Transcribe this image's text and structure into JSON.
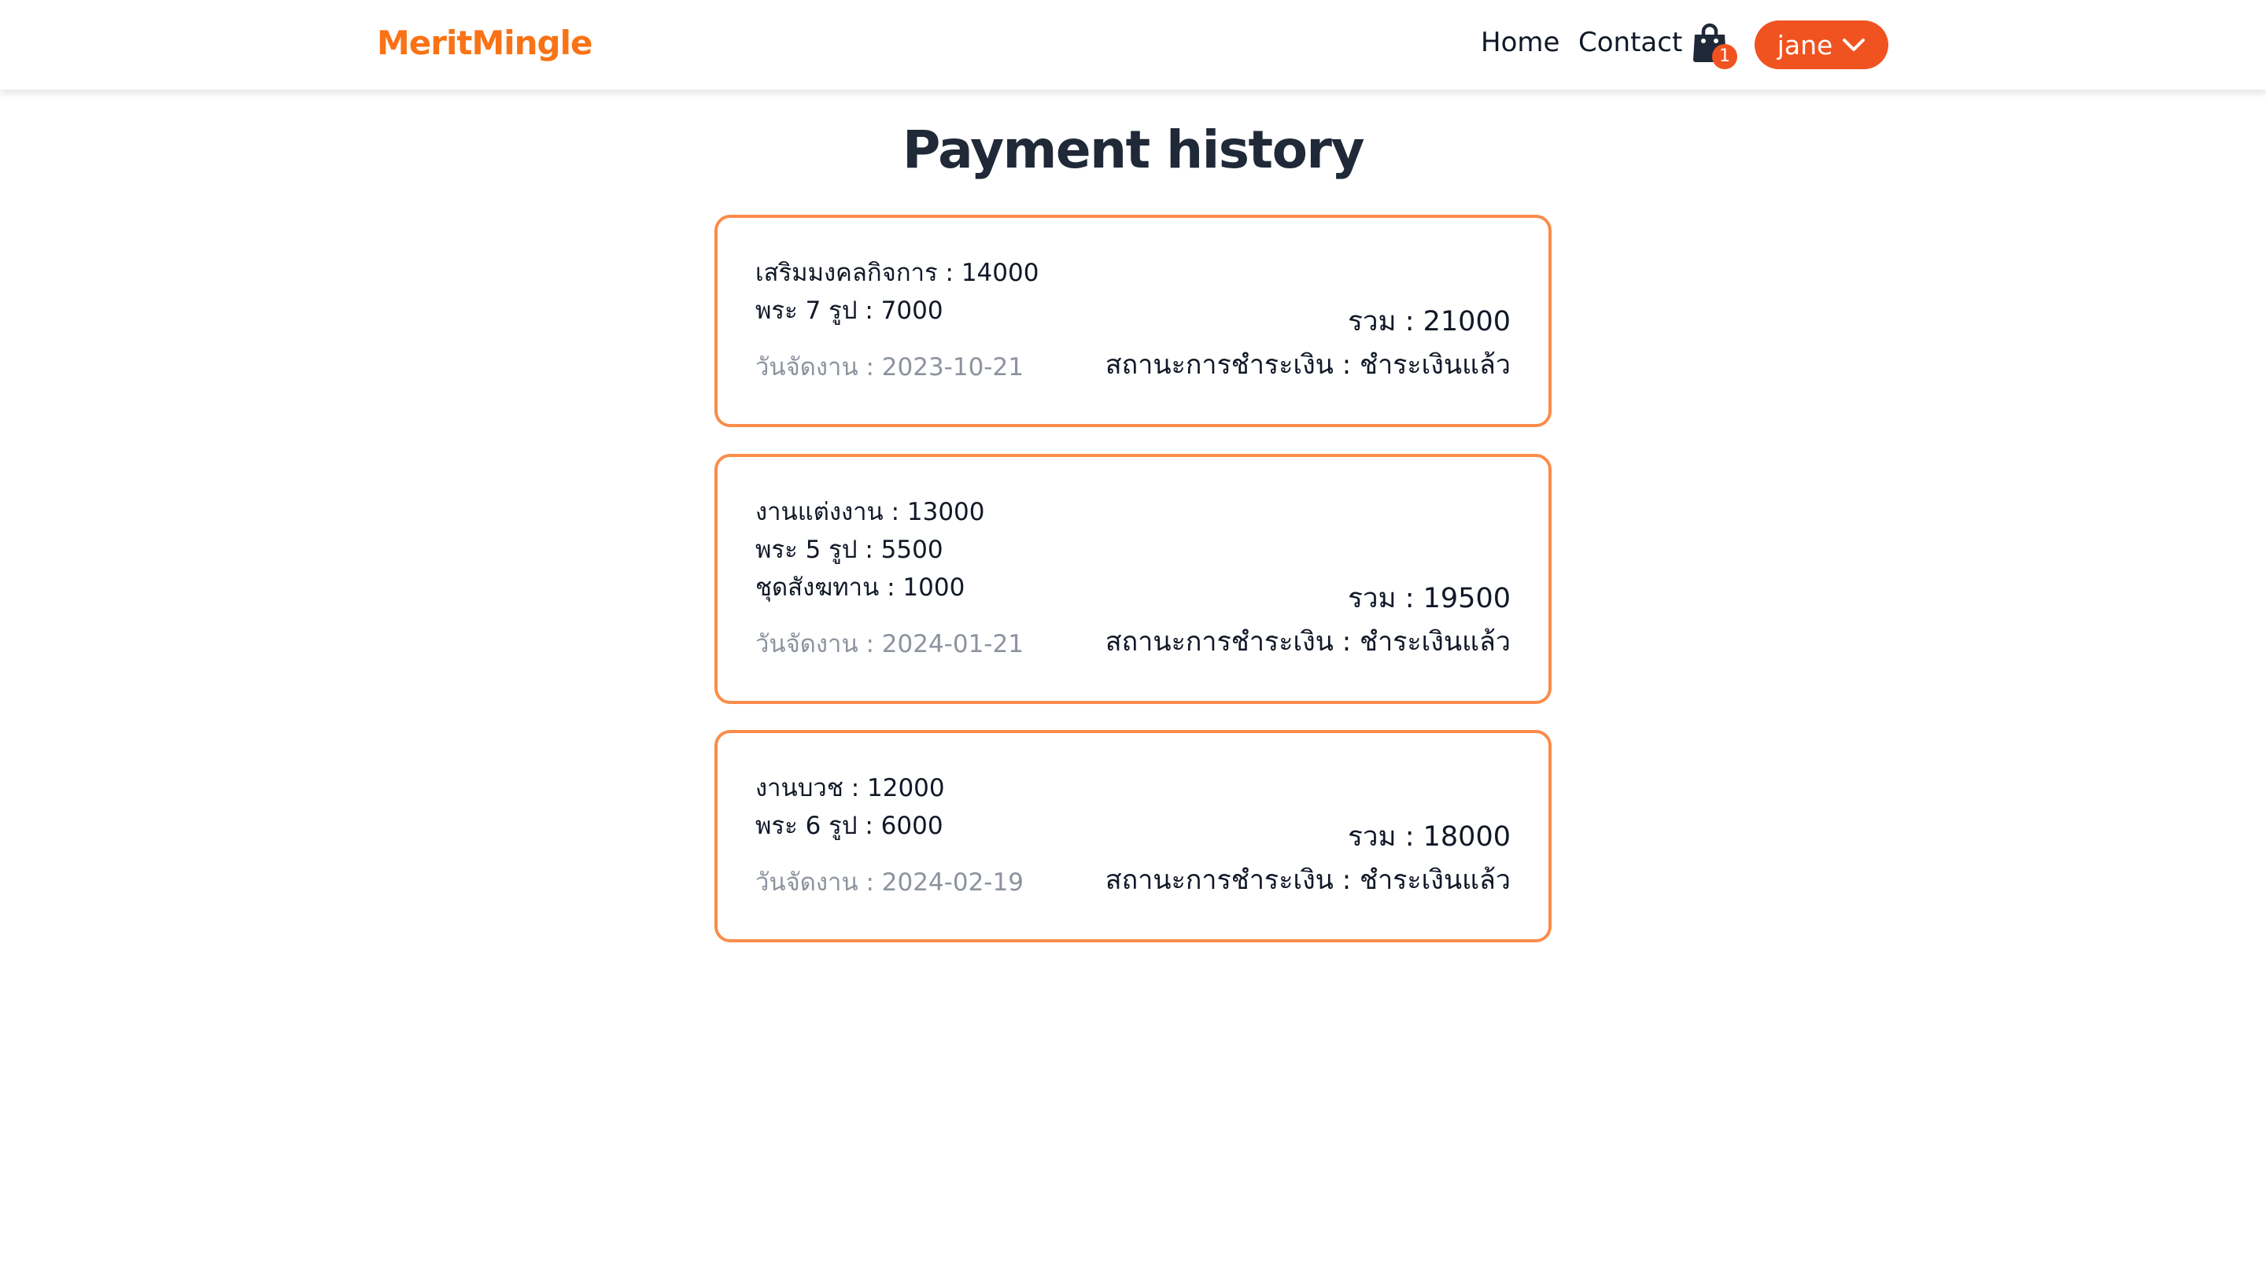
{
  "nav": {
    "brand": "MeritMingle",
    "home": "Home",
    "contact": "Contact",
    "cart_icon": "shopping-bag-icon",
    "cart_count": "1",
    "user_name": "jane",
    "user_icon": "chevron-down-icon"
  },
  "colors": {
    "brand": "#f97316",
    "accent": "#f0531f",
    "card_border": "#fb8c4a",
    "muted_text": "#8c939e"
  },
  "page": {
    "title": "Payment history"
  },
  "payments": [
    {
      "items": [
        "เสริมมงคลกิจการ : 14000",
        "พระ 7 รูป : 7000"
      ],
      "date": "วันจัดงาน : 2023-10-21",
      "total": "รวม : 21000",
      "status": "สถานะการชำระเงิน : ชำระเงินแล้ว"
    },
    {
      "items": [
        "งานแต่งงาน : 13000",
        "พระ 5 รูป : 5500",
        "ชุดสังฆทาน : 1000"
      ],
      "date": "วันจัดงาน : 2024-01-21",
      "total": "รวม : 19500",
      "status": "สถานะการชำระเงิน : ชำระเงินแล้ว"
    },
    {
      "items": [
        "งานบวช : 12000",
        "พระ 6 รูป : 6000"
      ],
      "date": "วันจัดงาน : 2024-02-19",
      "total": "รวม : 18000",
      "status": "สถานะการชำระเงิน : ชำระเงินแล้ว"
    }
  ]
}
